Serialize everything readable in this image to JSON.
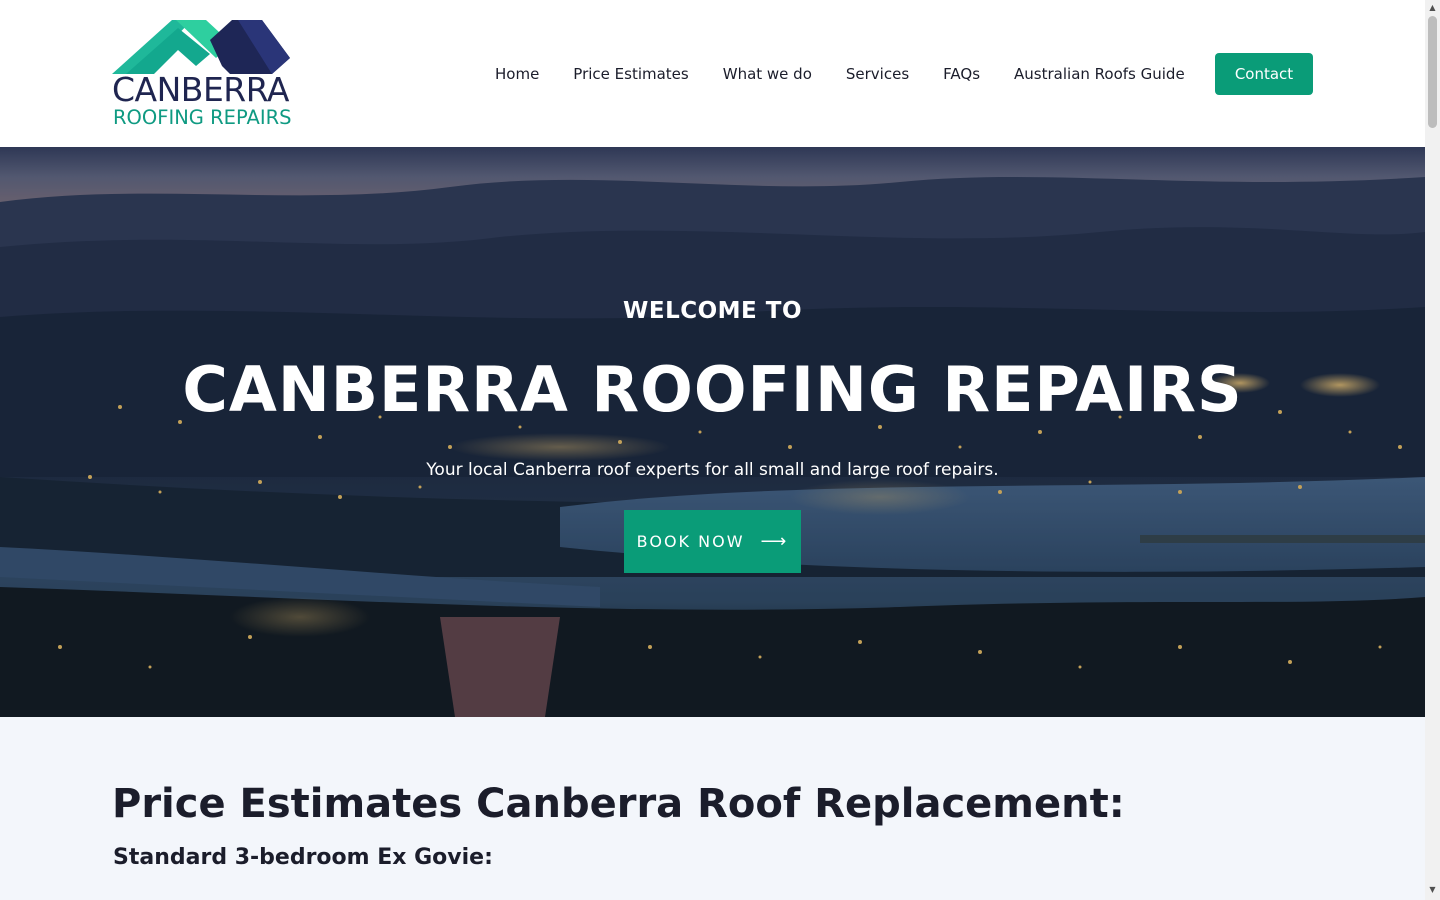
{
  "header": {
    "logo": {
      "line1": "CANBERRA",
      "line2": "ROOFING REPAIRS",
      "colors": {
        "navy": "#1f2550",
        "teal": "#0f9a82",
        "green": "#1fb89a"
      }
    },
    "nav": [
      {
        "label": "Home"
      },
      {
        "label": "Price Estimates"
      },
      {
        "label": "What we do"
      },
      {
        "label": "Services"
      },
      {
        "label": "FAQs"
      },
      {
        "label": "Australian Roofs Guide"
      }
    ],
    "contact_label": "Contact"
  },
  "hero": {
    "welcome": "WELCOME TO",
    "title": "CANBERRA ROOFING REPAIRS",
    "subtitle": "Your local Canberra roof experts for all small and large roof repairs.",
    "cta_label": "BOOK NOW",
    "cta_icon": "arrow-right-icon"
  },
  "main": {
    "heading": "Price Estimates Canberra Roof Replacement:",
    "subheading": "Standard 3-bedroom Ex Govie:"
  },
  "colors": {
    "accent": "#0a9c78",
    "text": "#1b1d2b",
    "section_bg": "#f3f6fb"
  }
}
